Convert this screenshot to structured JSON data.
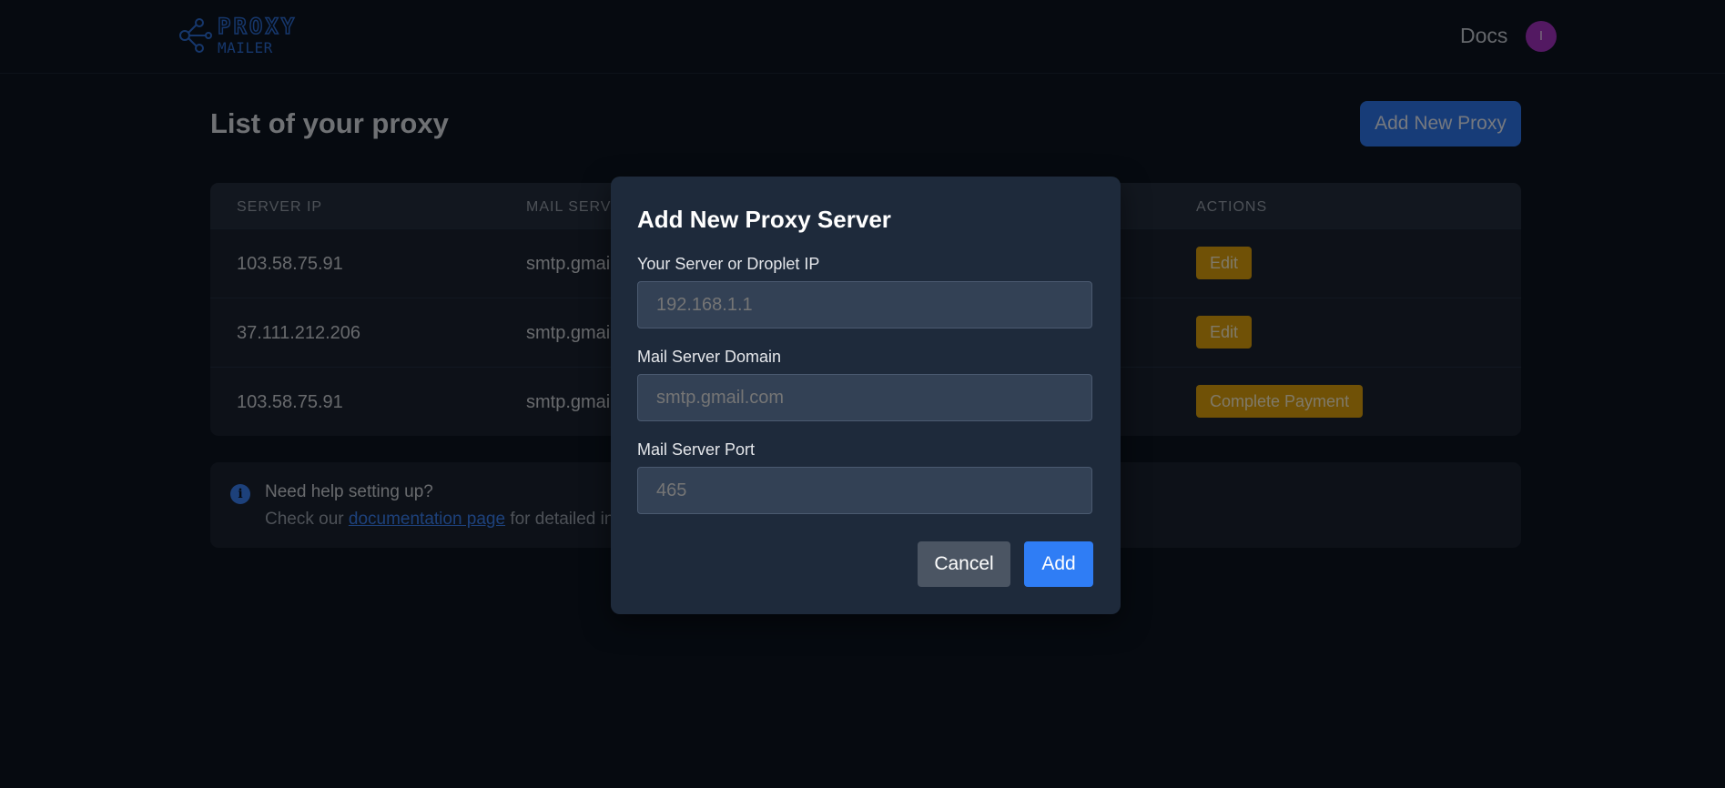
{
  "header": {
    "logo": {
      "line1": "PROXY",
      "line2": "MAILER",
      "icon": "network-nodes-icon",
      "color": "#2d6fd8"
    },
    "nav_docs": "Docs",
    "avatar_initial": "I",
    "avatar_color": "#a632c4"
  },
  "main": {
    "title": "List of your proxy",
    "add_button": "Add New Proxy",
    "table": {
      "headers": [
        "SERVER IP",
        "MAIL SERVE",
        "ACTIONS"
      ],
      "rows": [
        {
          "ip": "103.58.75.91",
          "mail": "smtp.gmai",
          "action": "Edit"
        },
        {
          "ip": "37.111.212.206",
          "mail": "smtp.gmai",
          "action": "Edit"
        },
        {
          "ip": "103.58.75.91",
          "mail": "smtp.gmai",
          "action": "Complete Payment"
        }
      ]
    },
    "help": {
      "icon": "info-icon",
      "title": "Need help setting up?",
      "prefix": "Check our ",
      "link": "documentation page",
      "suffix": " for detailed instru"
    }
  },
  "modal": {
    "title": "Add New Proxy Server",
    "fields": [
      {
        "label": "Your Server or Droplet IP",
        "placeholder": "192.168.1.1"
      },
      {
        "label": "Mail Server Domain",
        "placeholder": "smtp.gmail.com"
      },
      {
        "label": "Mail Server Port",
        "placeholder": "465"
      }
    ],
    "cancel_label": "Cancel",
    "add_label": "Add"
  },
  "colors": {
    "background": "#0d1420",
    "primary": "#2f79f0",
    "warning": "#e0a20c",
    "modal_bg": "#1e2a3b"
  }
}
